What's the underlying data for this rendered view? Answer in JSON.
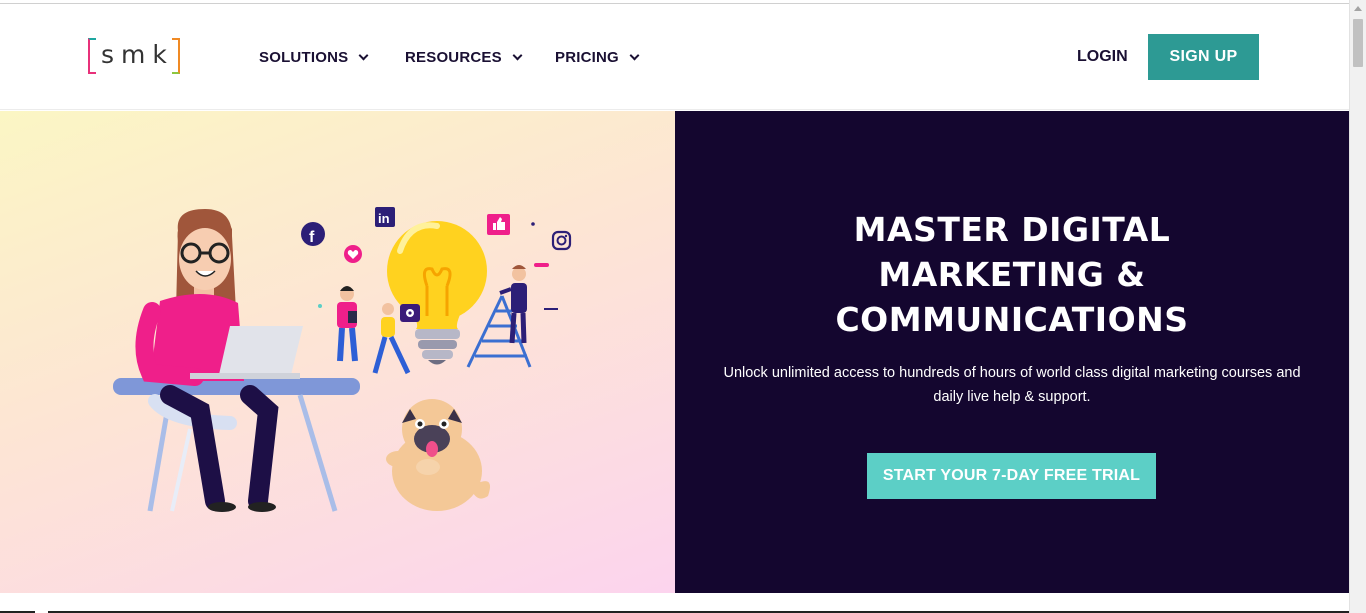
{
  "header": {
    "logo_text": "smk",
    "nav": [
      {
        "label": "SOLUTIONS"
      },
      {
        "label": "RESOURCES"
      },
      {
        "label": "PRICING"
      }
    ],
    "login_label": "LOGIN",
    "signup_label": "SIGN UP"
  },
  "hero": {
    "headline_lines": [
      "MASTER DIGITAL",
      "MARKETING &",
      "COMMUNICATIONS"
    ],
    "subtext": "Unlock unlimited access to hundreds of hours of world class digital marketing courses and daily live help & support.",
    "cta_label": "START YOUR 7-DAY FREE TRIAL",
    "illustration_icons": [
      "facebook-icon",
      "linkedin-icon",
      "like-icon",
      "instagram-icon",
      "heart-icon",
      "lightbulb-icon",
      "gear-icon"
    ]
  },
  "colors": {
    "brand_teal": "#2d9a94",
    "cta_teal": "#5ccfc6",
    "hero_dark": "#14062f",
    "nav_text": "#1a1033"
  }
}
